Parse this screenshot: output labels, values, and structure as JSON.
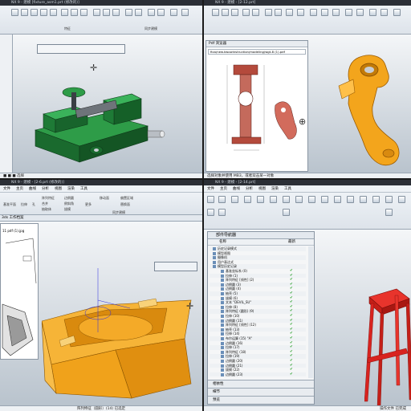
{
  "q1": {
    "title": "NX 9 - 建模 [fixture_asm1.prt (修改的)]",
    "ribbon_group_labels": [
      "特征",
      "同步建模"
    ],
    "status": "■ ■ ■ 选择"
  },
  "q2": {
    "title": "NX 9 - 建模 - [2-12.prt]",
    "image_window_title": "Pdf 浏览器",
    "url": "fixa/new.kwowinstruction/modeling/wgt-8 (1).pdf",
    "status": "选择对象并使用 MB3，或者双击某一对象"
  },
  "q3": {
    "title": "NX 9 - 建模 - [2-6.prt (修改的)]",
    "menu": [
      "文件",
      "主页",
      "曲线",
      "分析",
      "视图",
      "渲染",
      "工具"
    ],
    "tools": [
      "基准平面",
      "拉伸",
      "孔",
      "阵列特征",
      "合并",
      "抽取体",
      "边倒圆",
      "倒斜角",
      "拔模",
      "更多",
      "移动面",
      "偏置区域",
      "替换面",
      "同步建模"
    ],
    "file_tab": "3ds 工作档案",
    "doc_tab": "11 pdf (1).jpg",
    "status": "阵列特征（圆形）(14) 已选定"
  },
  "q4": {
    "title": "NX 9 - 建模 - [2-14.prt]",
    "menu": [
      "文件",
      "主页",
      "曲线",
      "分析",
      "视图",
      "渲染",
      "工具"
    ],
    "navigator_title": "部件导航器",
    "col_name": "名称",
    "col_latest": "最新",
    "tree": [
      "历史记录模式",
      "模型视图",
      "摄像机",
      "用户表达式",
      "模型历史记录",
      "基准坐标系 (0)",
      "拉伸 (1)",
      "阵列特征 [线性] (2)",
      "边倒圆 (3)",
      "边倒圆 (4)",
      "抽壳 (5)",
      "拔模 (6)",
      "文本 \"DEVIL_SU\"",
      "拉伸 (8)",
      "阵列特征 (圆形) (9)",
      "拉伸 (10)",
      "边倒圆 (11)",
      "阵列特征 [线性] (12)",
      "抽壳 (13)",
      "拉伸 (14)",
      "布尔运算 (15) \"A\"",
      "边倒圆 (16)",
      "拉伸 (17)",
      "阵列特征 (18)",
      "拉伸 (19)",
      "边倒圆 (20)",
      "边倒圆 (21)",
      "拔模 (22)",
      "边倒圆 (23)"
    ],
    "sections": [
      "相依性",
      "细节",
      "预览"
    ],
    "status": "操作文件 已完成"
  },
  "colors": {
    "title_bar": "#2b2f36",
    "ribbon": "#e6ebf0",
    "green_part": "#1f7a37",
    "orange_part": "#f0a21b",
    "red_part": "#d8231f",
    "check": "#1a9a1a"
  }
}
